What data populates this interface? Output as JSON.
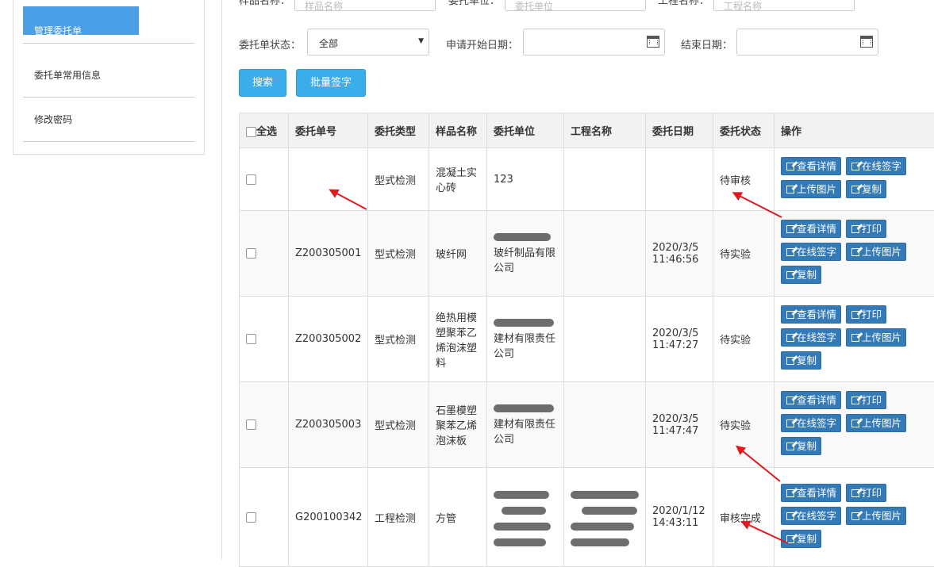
{
  "sidebar": {
    "items": [
      {
        "label": "管理委托单",
        "active": true
      },
      {
        "label": "委托单常用信息",
        "active": false
      },
      {
        "label": "修改密码",
        "active": false
      }
    ]
  },
  "filters": {
    "sample_name_label": "样品名称：",
    "sample_name_placeholder": "样品名称",
    "client_unit_label": "委托单位：",
    "client_unit_placeholder": "委托单位",
    "project_name_label": "工程名称：",
    "project_name_placeholder": "工程名称",
    "status_label": "委托单状态：",
    "status_value": "全部",
    "start_date_label": "申请开始日期：",
    "end_date_label": "结束日期："
  },
  "actions": {
    "search": "搜索",
    "batch_sign": "批量签字"
  },
  "table": {
    "headers": {
      "select_all": "全选",
      "order_no": "委托单号",
      "type": "委托类型",
      "sample": "样品名称",
      "client": "委托单位",
      "project": "工程名称",
      "date": "委托日期",
      "status": "委托状态",
      "ops": "操作"
    },
    "button_labels": {
      "view": "查看详情",
      "sign": "在线签字",
      "upload": "上传图片",
      "copy": "复制",
      "print": "打印"
    },
    "rows": [
      {
        "order_no": "",
        "type": "型式检测",
        "sample": "混凝土实心砖",
        "client": "123",
        "project": "",
        "date": "",
        "status": "待审核"
      },
      {
        "order_no": "Z200305001",
        "type": "型式检测",
        "sample": "玻纤网",
        "client": "玻纤制品有限公司",
        "project": "",
        "date": "2020/3/5 11:46:56",
        "status": "待实验"
      },
      {
        "order_no": "Z200305002",
        "type": "型式检测",
        "sample": "绝热用模塑聚苯乙烯泡沫塑料",
        "client": "建材有限责任公司",
        "project": "",
        "date": "2020/3/5 11:47:27",
        "status": "待实验"
      },
      {
        "order_no": "Z200305003",
        "type": "型式检测",
        "sample": "石墨模塑聚苯乙烯泡沫板",
        "client": "建材有限责任公司",
        "project": "",
        "date": "2020/3/5 11:47:47",
        "status": "待实验"
      },
      {
        "order_no": "G200100342",
        "type": "工程检测",
        "sample": "方管",
        "client": "",
        "project": "",
        "date": "2020/1/12 14:43:11",
        "status": "审核完成"
      }
    ]
  },
  "colors": {
    "accent": "#4a9fe6",
    "primary_button": "#3aaeea",
    "op_button": "#337ab7",
    "annotation_arrow": "#e0191f"
  }
}
